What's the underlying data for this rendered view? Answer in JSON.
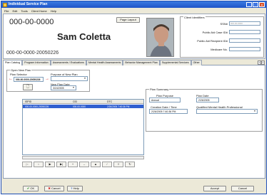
{
  "window": {
    "title": "Individual Service Plan",
    "controls": [
      "_",
      "□",
      "x"
    ]
  },
  "menu": [
    "File",
    "Edit",
    "Tools",
    "Client Home",
    "Help"
  ],
  "header": {
    "client_id": "000-00-0000",
    "client_name": "Sam  Coletta",
    "plan_id": "000-00-0000-20050226",
    "page_layout_label": "Page Layout"
  },
  "client_identifiers": {
    "legend": "Client Identifiers",
    "rows": [
      {
        "label": "SSN#",
        "value": "000-00-0000"
      },
      {
        "label": "Public Aid Case ID#",
        "value": ""
      },
      {
        "label": "Public Aid Recipient ID#",
        "value": ""
      },
      {
        "label": "Medicare No.",
        "value": ""
      }
    ]
  },
  "tabs": [
    "Plan Catalog",
    "Program Information",
    "Assessments / Evaluations",
    "Mental Health Assessments",
    "Behavior Management Plan",
    "Supplemental Services",
    "Other"
  ],
  "open_new_plan": {
    "legend": "Open New Plan",
    "plan_selector_label": "Plan Selector",
    "plan_selector_value": "000-00-0000-20050226",
    "purpose_label": "Purpose of New Plan",
    "new_plan_date_label": "New Plan Date",
    "new_plan_date_value": "3/24/2005"
  },
  "plan_table": {
    "columns": [
      "ISPID",
      "CID",
      "DTC"
    ],
    "rows": [
      [
        "000-00-0000-20050226",
        "000-00-0000",
        "2/26/2005 7:40:36 PM"
      ]
    ]
  },
  "nav_buttons": [
    "|<",
    "<",
    "▶",
    "▶|",
    "+",
    "–",
    "▲",
    "✓",
    "✕",
    "↻"
  ],
  "plan_summary": {
    "legend": "Plan Summary",
    "plan_purpose_label": "Plan Purpose",
    "plan_purpose_value": "Annual",
    "plan_date_label": "Plan Date",
    "plan_date_value": "2/26/2005",
    "creation_label": "Creation Date / Time",
    "creation_value": "2/26/2005 7:40:36 PM",
    "qmhp_label": "Qualified Mental Health Professional",
    "qmhp_value": ""
  },
  "bottom": {
    "ok": "OK",
    "cancel": "Cancel",
    "help": "Help",
    "accept": "Accept",
    "cancel2": "Cancel"
  },
  "colors": {
    "titlebar": "#1f55c8",
    "selection": "#2f5fd0",
    "arrow": "#d02020"
  }
}
